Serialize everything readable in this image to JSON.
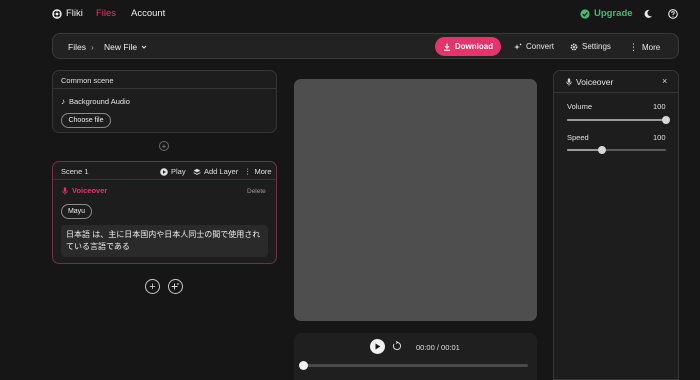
{
  "nav": {
    "logo": "Fliki",
    "files": "Files",
    "account": "Account",
    "upgrade": "Upgrade"
  },
  "toolbar": {
    "breadcrumb_root": "Files",
    "separator": "›",
    "file_name": "New File",
    "download": "Download",
    "convert": "Convert",
    "settings": "Settings",
    "more": "More"
  },
  "common_scene": {
    "title": "Common scene",
    "background_audio": "Background Audio",
    "choose_file": "Choose file"
  },
  "scene": {
    "title": "Scene 1",
    "play": "Play",
    "add_layer": "Add Layer",
    "more": "More",
    "voiceover_label": "Voiceover",
    "delete": "Delete",
    "voice_name": "Mayu",
    "text": "日本語 は、主に日本国内や日本人同士の間で使用されている言語である"
  },
  "player": {
    "time": "00:00 / 00:01",
    "progress": 0
  },
  "voiceover_panel": {
    "title": "Voiceover",
    "volume_label": "Volume",
    "volume_value": "100",
    "volume_fraction": 1.0,
    "speed_label": "Speed",
    "speed_value": "100",
    "speed_fraction": 0.35
  },
  "colors": {
    "accent": "#e5336b",
    "upgrade": "#48b874",
    "preview_bg": "#4e4e4e"
  }
}
